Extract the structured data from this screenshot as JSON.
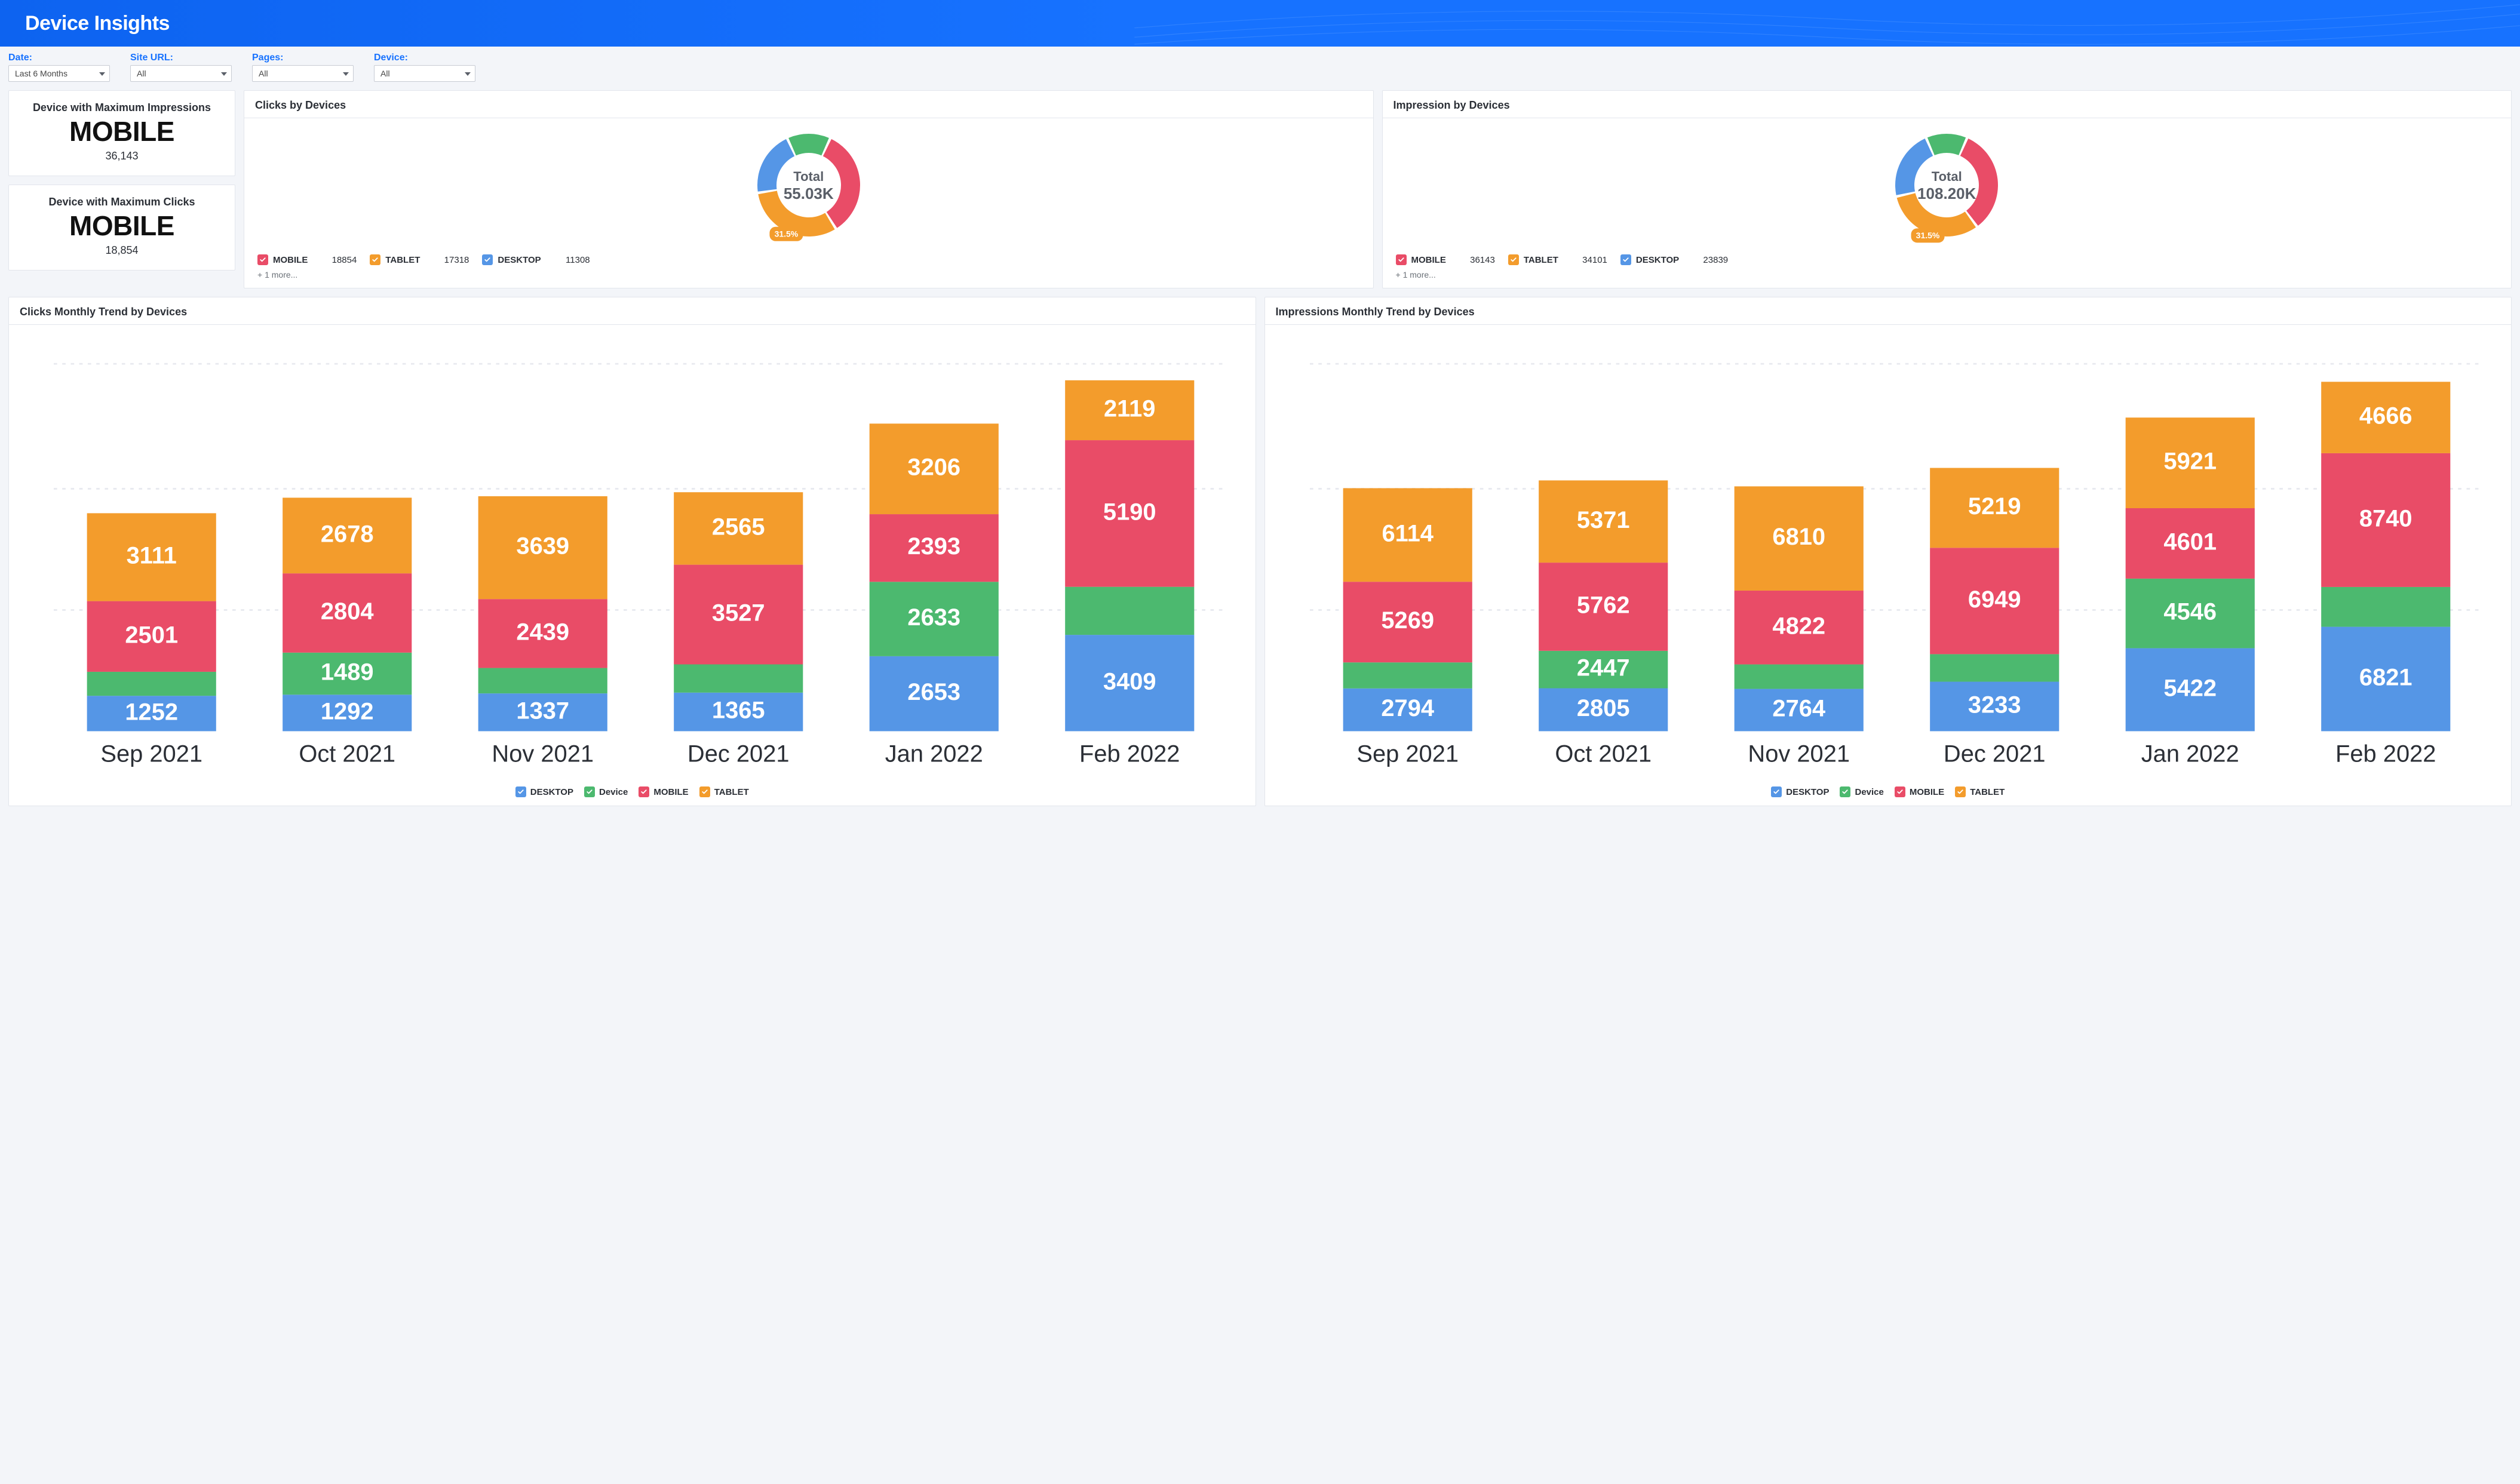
{
  "header": {
    "title": "Device Insights"
  },
  "filters": [
    {
      "label": "Date:",
      "value": "Last 6 Months"
    },
    {
      "label": "Site URL:",
      "value": "All"
    },
    {
      "label": "Pages:",
      "value": "All"
    },
    {
      "label": "Device:",
      "value": "All"
    }
  ],
  "kpis": {
    "max_impressions": {
      "title": "Device with Maximum Impressions",
      "value": "MOBILE",
      "sub": "36,143"
    },
    "max_clicks": {
      "title": "Device with Maximum Clicks",
      "value": "MOBILE",
      "sub": "18,854"
    }
  },
  "donuts": {
    "clicks": {
      "title": "Clicks by Devices",
      "center_label": "Total",
      "center_value": "55.03K",
      "callout": "31.5%",
      "legend": [
        {
          "name": "MOBILE",
          "value": "18854",
          "color": "#e94c67"
        },
        {
          "name": "TABLET",
          "value": "17318",
          "color": "#f39c2c"
        },
        {
          "name": "DESKTOP",
          "value": "11308",
          "color": "#5596e6"
        }
      ],
      "more": "+ 1 more..."
    },
    "impressions": {
      "title": "Impression by Devices",
      "center_label": "Total",
      "center_value": "108.20K",
      "callout": "31.5%",
      "legend": [
        {
          "name": "MOBILE",
          "value": "36143",
          "color": "#e94c67"
        },
        {
          "name": "TABLET",
          "value": "34101",
          "color": "#f39c2c"
        },
        {
          "name": "DESKTOP",
          "value": "23839",
          "color": "#5596e6"
        }
      ],
      "more": "+ 1 more..."
    }
  },
  "stacked": {
    "clicks": {
      "title": "Clicks Monthly Trend by Devices"
    },
    "impressions": {
      "title": "Impressions Monthly Trend by Devices"
    },
    "legend": [
      {
        "name": "DESKTOP",
        "color": "#5596e6"
      },
      {
        "name": "Device",
        "color": "#4cb96f"
      },
      {
        "name": "MOBILE",
        "color": "#e94c67"
      },
      {
        "name": "TABLET",
        "color": "#f39c2c"
      }
    ]
  },
  "chart_data": [
    {
      "type": "pie",
      "title": "Clicks by Devices",
      "total_label": "Total",
      "total_value": "55.03K",
      "callout_percent": 31.5,
      "series": [
        {
          "name": "MOBILE",
          "value": 18854,
          "color": "#e94c67"
        },
        {
          "name": "TABLET",
          "value": 17318,
          "color": "#f39c2c"
        },
        {
          "name": "DESKTOP",
          "value": 11308,
          "color": "#5596e6"
        },
        {
          "name": "Device",
          "value": 7550,
          "color": "#4cb96f"
        }
      ]
    },
    {
      "type": "pie",
      "title": "Impression by Devices",
      "total_label": "Total",
      "total_value": "108.20K",
      "callout_percent": 31.5,
      "series": [
        {
          "name": "MOBILE",
          "value": 36143,
          "color": "#e94c67"
        },
        {
          "name": "TABLET",
          "value": 34101,
          "color": "#f39c2c"
        },
        {
          "name": "DESKTOP",
          "value": 23839,
          "color": "#5596e6"
        },
        {
          "name": "Device",
          "value": 14117,
          "color": "#4cb96f"
        }
      ]
    },
    {
      "type": "bar",
      "stacked": true,
      "title": "Clicks Monthly Trend by Devices",
      "categories": [
        "Sep 2021",
        "Oct 2021",
        "Nov 2021",
        "Dec 2021",
        "Jan 2022",
        "Feb 2022"
      ],
      "series": [
        {
          "name": "DESKTOP",
          "color": "#5596e6",
          "values": [
            1252,
            1292,
            1337,
            1365,
            2653,
            3409
          ]
        },
        {
          "name": "Device",
          "color": "#4cb96f",
          "values": [
            850,
            1489,
            900,
            1000,
            2633,
            1700
          ]
        },
        {
          "name": "MOBILE",
          "color": "#e94c67",
          "values": [
            2501,
            2804,
            2439,
            3527,
            2393,
            5190
          ]
        },
        {
          "name": "TABLET",
          "color": "#f39c2c",
          "values": [
            3111,
            2678,
            3639,
            2565,
            3206,
            2119
          ]
        }
      ],
      "visible_labels": {
        "DESKTOP": [
          1252,
          1292,
          1337,
          1365,
          2653,
          3409
        ],
        "Device": [
          null,
          1489,
          null,
          null,
          2633,
          null
        ],
        "MOBILE": [
          2501,
          2804,
          2439,
          3527,
          2393,
          5190
        ],
        "TABLET": [
          3111,
          2678,
          3639,
          2565,
          3206,
          2119
        ]
      },
      "ylim": [
        0,
        13000
      ]
    },
    {
      "type": "bar",
      "stacked": true,
      "title": "Impressions Monthly Trend by Devices",
      "categories": [
        "Sep 2021",
        "Oct 2021",
        "Nov 2021",
        "Dec 2021",
        "Jan 2022",
        "Feb 2022"
      ],
      "series": [
        {
          "name": "DESKTOP",
          "color": "#5596e6",
          "values": [
            2794,
            2805,
            2764,
            3233,
            5422,
            6821
          ]
        },
        {
          "name": "Device",
          "color": "#4cb96f",
          "values": [
            1700,
            2447,
            1600,
            1800,
            4546,
            2600
          ]
        },
        {
          "name": "MOBILE",
          "color": "#e94c67",
          "values": [
            5269,
            5762,
            4822,
            6949,
            4601,
            8740
          ]
        },
        {
          "name": "TABLET",
          "color": "#f39c2c",
          "values": [
            6114,
            5371,
            6810,
            5219,
            5921,
            4666
          ]
        }
      ],
      "visible_labels": {
        "DESKTOP": [
          2794,
          2805,
          2764,
          3233,
          5422,
          6821
        ],
        "Device": [
          null,
          2447,
          null,
          null,
          4546,
          null
        ],
        "MOBILE": [
          5269,
          5762,
          4822,
          6949,
          4601,
          8740
        ],
        "TABLET": [
          6114,
          5371,
          6810,
          5219,
          5921,
          4666
        ]
      },
      "ylim": [
        0,
        24000
      ]
    }
  ]
}
